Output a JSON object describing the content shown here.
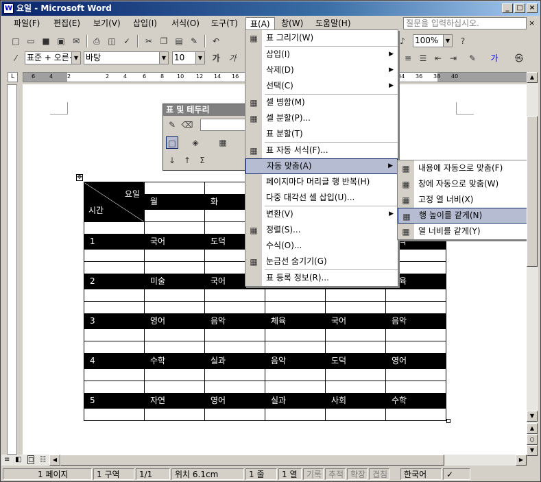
{
  "window": {
    "title": "요일 - Microsoft Word"
  },
  "menubar": {
    "items": [
      "파일(F)",
      "편집(E)",
      "보기(V)",
      "삽입(I)",
      "서식(O)",
      "도구(T)",
      "표(A)",
      "창(W)",
      "도움말(H)"
    ],
    "help_placeholder": "질문을 입력하십시오."
  },
  "toolbar": {
    "zoom": "100%",
    "style": "표준 + 오른·",
    "font": "바탕",
    "size": "10"
  },
  "ruler": {
    "numbers": [
      "6",
      "4",
      "2",
      "2",
      "4",
      "6",
      "8",
      "10",
      "12",
      "14",
      "16",
      "34",
      "36",
      "38",
      "40"
    ]
  },
  "float_toolbar": {
    "title": "표 및 테두리"
  },
  "table_menu": {
    "items": [
      {
        "label": "표 그리기(W)",
        "icon": "pencil-icon"
      },
      {
        "sep": true
      },
      {
        "label": "삽입(I)",
        "submenu": true
      },
      {
        "label": "삭제(D)",
        "submenu": true
      },
      {
        "label": "선택(C)",
        "submenu": true
      },
      {
        "sep": true
      },
      {
        "label": "셀 병합(M)",
        "icon": "merge-cells-icon"
      },
      {
        "label": "셀 분할(P)...",
        "icon": "split-cells-icon"
      },
      {
        "label": "표 분할(T)"
      },
      {
        "sep": true
      },
      {
        "label": "표 자동 서식(F)...",
        "icon": "autoformat-icon"
      },
      {
        "label": "자동 맞춤(A)",
        "submenu": true,
        "highlight": true
      },
      {
        "label": "페이지마다 머리글 행 반복(H)"
      },
      {
        "label": "다중 대각선 셀 삽입(U)..."
      },
      {
        "sep": true
      },
      {
        "label": "변환(V)",
        "submenu": true
      },
      {
        "label": "정렬(S)...",
        "icon": "sort-icon"
      },
      {
        "label": "수식(O)..."
      },
      {
        "label": "눈금선 숨기기(G)",
        "icon": "gridlines-icon"
      },
      {
        "sep": true
      },
      {
        "label": "표 등록 정보(R)..."
      }
    ]
  },
  "autofit_menu": {
    "items": [
      {
        "label": "내용에 자동으로 맞춤(F)",
        "icon": "autofit-contents-icon"
      },
      {
        "label": "창에 자동으로 맞춤(W)",
        "icon": "autofit-window-icon"
      },
      {
        "label": "고정 열 너비(X)",
        "icon": "fixed-width-icon"
      },
      {
        "label": "행 높이를 같게(N)",
        "icon": "distribute-rows-icon",
        "highlight": true
      },
      {
        "label": "열 너비를 같게(Y)",
        "icon": "distribute-cols-icon"
      }
    ]
  },
  "table": {
    "header": {
      "corner_top": "요일",
      "corner_bottom": "시간",
      "days": [
        "월",
        "화",
        "",
        "",
        ""
      ]
    },
    "rows": [
      {
        "period": "1",
        "cells": [
          "국어",
          "도덕",
          "",
          "",
          "음악"
        ]
      },
      {
        "period": "2",
        "cells": [
          "미술",
          "국어",
          "",
          "",
          "체육"
        ]
      },
      {
        "period": "3",
        "cells": [
          "영어",
          "음악",
          "체육",
          "국어",
          "음악"
        ]
      },
      {
        "period": "4",
        "cells": [
          "수학",
          "실과",
          "음악",
          "도덕",
          "영어"
        ]
      },
      {
        "period": "5",
        "cells": [
          "자연",
          "영어",
          "실과",
          "사회",
          "수학"
        ]
      }
    ]
  },
  "status": {
    "page": "1 페이지",
    "section": "1 구역",
    "pages": "1/1",
    "position": "위치 6.1cm",
    "line": "1 줄",
    "col": "1 열",
    "rec": "기록",
    "trk": "추적",
    "ext": "확장",
    "ovr": "겹침",
    "lang": "한국어"
  }
}
